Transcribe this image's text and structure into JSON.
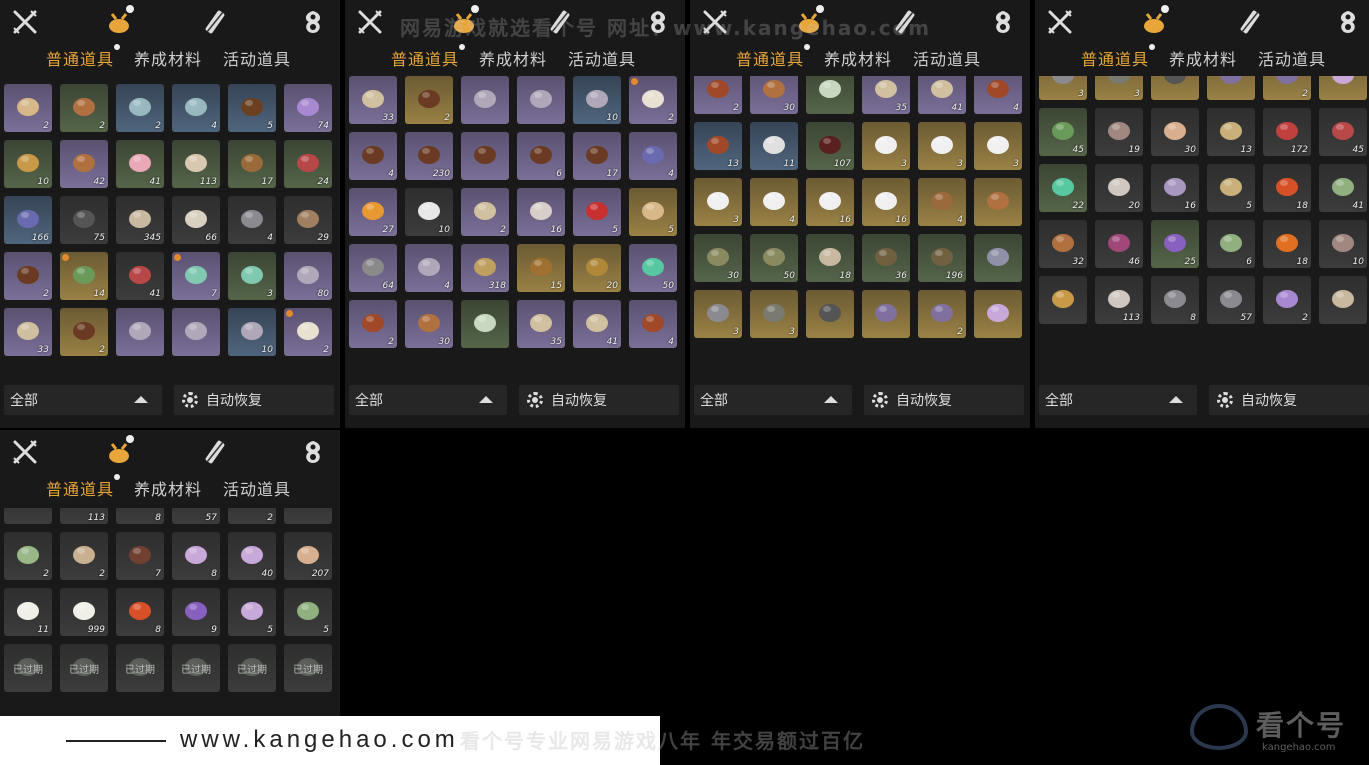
{
  "colors": {
    "tab_active": "#e8a63a",
    "tab_inactive": "#d0d0d0",
    "panel_bg": "#191919"
  },
  "nav_icons": [
    "crossed-swords-icon",
    "pouch-icon",
    "scroll-icon",
    "spirit-icon"
  ],
  "tabs": [
    "普通道具",
    "养成材料",
    "活动道具"
  ],
  "footer": {
    "filter": "全部",
    "auto": "自动恢复"
  },
  "expired_label": "已过期",
  "watermark": "网易游戏就选看个号   网址：www.kangehao.com",
  "banner": {
    "url": "www.kangehao.com",
    "slogan": "看个号专业网易游戏八年   年交易额过百亿"
  },
  "logo": {
    "name": "看个号",
    "site": "kangehao.com"
  },
  "panels": [
    {
      "items": [
        {
          "c": "2",
          "bg": "purple",
          "icon": "banner-icon"
        },
        {
          "c": "2",
          "bg": "green",
          "icon": "food-bowl-icon"
        },
        {
          "c": "2",
          "bg": "blue",
          "icon": "cloth-bag-icon"
        },
        {
          "c": "4",
          "bg": "blue",
          "icon": "cloth-bag-icon"
        },
        {
          "c": "5",
          "bg": "blue",
          "icon": "nuts-icon"
        },
        {
          "c": "74",
          "bg": "purple",
          "icon": "crystal-icon"
        },
        {
          "c": "10",
          "bg": "green",
          "icon": "ore-icon"
        },
        {
          "c": "42",
          "bg": "purple",
          "icon": "food-bowl-icon"
        },
        {
          "c": "41",
          "bg": "green",
          "icon": "blossom-icon"
        },
        {
          "c": "113",
          "bg": "green",
          "icon": "mushroom-icon"
        },
        {
          "c": "17",
          "bg": "green",
          "icon": "wood-icon"
        },
        {
          "c": "24",
          "bg": "green",
          "icon": "meat-icon"
        },
        {
          "c": "166",
          "bg": "blue",
          "icon": "box-icon"
        },
        {
          "c": "75",
          "bg": "grey",
          "icon": "insect-icon"
        },
        {
          "c": "345",
          "bg": "grey",
          "icon": "sack-icon"
        },
        {
          "c": "66",
          "bg": "grey",
          "icon": "eggs-icon"
        },
        {
          "c": "4",
          "bg": "grey",
          "icon": "stone-icon"
        },
        {
          "c": "29",
          "bg": "grey",
          "icon": "sticks-icon"
        },
        {
          "c": "2",
          "bg": "purple",
          "icon": "chest-icon"
        },
        {
          "c": "14",
          "bg": "gold",
          "icon": "bamboo-icon",
          "dot": true
        },
        {
          "c": "41",
          "bg": "grey",
          "icon": "meat-icon"
        },
        {
          "c": "7",
          "bg": "purple",
          "icon": "tickets-icon",
          "dot": true
        },
        {
          "c": "3",
          "bg": "green",
          "icon": "tickets-icon"
        },
        {
          "c": "80",
          "bg": "purple",
          "icon": "pouch-icon"
        },
        {
          "c": "33",
          "bg": "purple",
          "icon": "letter-icon"
        },
        {
          "c": "2",
          "bg": "gold",
          "icon": "chest-icon"
        },
        {
          "c": "",
          "bg": "purple",
          "icon": "pouch-icon"
        },
        {
          "c": "",
          "bg": "purple",
          "icon": "pouch-icon"
        },
        {
          "c": "10",
          "bg": "blue",
          "icon": "pouch-icon"
        },
        {
          "c": "2",
          "bg": "purple",
          "icon": "gourd-icon",
          "dot": true
        }
      ]
    },
    {
      "items": [
        {
          "c": "33",
          "bg": "purple",
          "icon": "letter-icon"
        },
        {
          "c": "2",
          "bg": "gold",
          "icon": "chest-icon"
        },
        {
          "c": "",
          "bg": "purple",
          "icon": "pouch-icon"
        },
        {
          "c": "",
          "bg": "purple",
          "icon": "pouch-icon"
        },
        {
          "c": "10",
          "bg": "blue",
          "icon": "pouch-icon"
        },
        {
          "c": "2",
          "bg": "purple",
          "icon": "gourd-icon",
          "dot": true
        },
        {
          "c": "4",
          "bg": "purple",
          "icon": "chest-icon"
        },
        {
          "c": "230",
          "bg": "purple",
          "icon": "chest-icon"
        },
        {
          "c": "",
          "bg": "purple",
          "icon": "chest-icon"
        },
        {
          "c": "6",
          "bg": "purple",
          "icon": "chest-icon"
        },
        {
          "c": "17",
          "bg": "purple",
          "icon": "chest-icon"
        },
        {
          "c": "4",
          "bg": "purple",
          "icon": "box-icon"
        },
        {
          "c": "27",
          "bg": "purple",
          "icon": "orb-icon"
        },
        {
          "c": "10",
          "bg": "grey",
          "icon": "mountain-token-icon"
        },
        {
          "c": "2",
          "bg": "purple",
          "icon": "letter-icon"
        },
        {
          "c": "16",
          "bg": "purple",
          "icon": "jar-icon"
        },
        {
          "c": "5",
          "bg": "purple",
          "icon": "red-envelope-icon"
        },
        {
          "c": "5",
          "bg": "gold",
          "icon": "banner-icon"
        },
        {
          "c": "64",
          "bg": "purple",
          "icon": "token-icon"
        },
        {
          "c": "4",
          "bg": "purple",
          "icon": "pouch-icon"
        },
        {
          "c": "318",
          "bg": "purple",
          "icon": "ladder-icon"
        },
        {
          "c": "15",
          "bg": "gold",
          "icon": "helmet-icon"
        },
        {
          "c": "20",
          "bg": "gold",
          "icon": "coin-icon"
        },
        {
          "c": "50",
          "bg": "purple",
          "icon": "jade-icon"
        },
        {
          "c": "2",
          "bg": "purple",
          "icon": "horn-icon"
        },
        {
          "c": "30",
          "bg": "purple",
          "icon": "food-bowl-icon"
        },
        {
          "c": "",
          "bg": "green",
          "icon": "vase-icon"
        },
        {
          "c": "35",
          "bg": "purple",
          "icon": "letter-icon"
        },
        {
          "c": "41",
          "bg": "purple",
          "icon": "letter-icon"
        },
        {
          "c": "4",
          "bg": "purple",
          "icon": "horn-icon"
        }
      ]
    },
    {
      "items": [
        {
          "c": "2",
          "bg": "purple",
          "icon": "horn-icon"
        },
        {
          "c": "30",
          "bg": "purple",
          "icon": "food-bowl-icon"
        },
        {
          "c": "",
          "bg": "green",
          "icon": "vase-icon"
        },
        {
          "c": "35",
          "bg": "purple",
          "icon": "letter-icon"
        },
        {
          "c": "41",
          "bg": "purple",
          "icon": "letter-icon"
        },
        {
          "c": "4",
          "bg": "purple",
          "icon": "horn-icon"
        },
        {
          "c": "13",
          "bg": "blue",
          "icon": "horn-icon"
        },
        {
          "c": "11",
          "bg": "blue",
          "icon": "teapot-icon"
        },
        {
          "c": "107",
          "bg": "green",
          "icon": "wine-jar-icon"
        },
        {
          "c": "3",
          "bg": "gold",
          "icon": "bowl-icon"
        },
        {
          "c": "3",
          "bg": "gold",
          "icon": "bowl-icon"
        },
        {
          "c": "3",
          "bg": "gold",
          "icon": "bowl-icon"
        },
        {
          "c": "3",
          "bg": "gold",
          "icon": "bowl-icon"
        },
        {
          "c": "4",
          "bg": "gold",
          "icon": "bowl-icon"
        },
        {
          "c": "16",
          "bg": "gold",
          "icon": "plate-icon"
        },
        {
          "c": "16",
          "bg": "gold",
          "icon": "bowl-icon"
        },
        {
          "c": "4",
          "bg": "gold",
          "icon": "wood-icon"
        },
        {
          "c": "",
          "bg": "gold",
          "icon": "food-bowl-icon"
        },
        {
          "c": "30",
          "bg": "green",
          "icon": "powder-icon"
        },
        {
          "c": "50",
          "bg": "green",
          "icon": "powder-icon"
        },
        {
          "c": "18",
          "bg": "green",
          "icon": "sack-icon"
        },
        {
          "c": "36",
          "bg": "green",
          "icon": "arrow-icon"
        },
        {
          "c": "196",
          "bg": "green",
          "icon": "arrow-icon"
        },
        {
          "c": "",
          "bg": "green",
          "icon": "net-icon"
        },
        {
          "c": "3",
          "bg": "gold",
          "icon": "stone-icon"
        },
        {
          "c": "3",
          "bg": "gold",
          "icon": "egg-icon"
        },
        {
          "c": "",
          "bg": "gold",
          "icon": "insect-icon"
        },
        {
          "c": "",
          "bg": "gold",
          "icon": "dragonfly-icon"
        },
        {
          "c": "2",
          "bg": "gold",
          "icon": "dragonfly-icon"
        },
        {
          "c": "",
          "bg": "gold",
          "icon": "flower-icon"
        }
      ]
    },
    {
      "items": [
        {
          "c": "3",
          "bg": "gold",
          "icon": "stone-icon"
        },
        {
          "c": "3",
          "bg": "gold",
          "icon": "egg-icon"
        },
        {
          "c": "",
          "bg": "gold",
          "icon": "insect-icon"
        },
        {
          "c": "",
          "bg": "gold",
          "icon": "dragonfly-icon"
        },
        {
          "c": "2",
          "bg": "gold",
          "icon": "dragonfly-icon"
        },
        {
          "c": "",
          "bg": "gold",
          "icon": "flower-icon"
        },
        {
          "c": "45",
          "bg": "green",
          "icon": "bamboo-icon"
        },
        {
          "c": "19",
          "bg": "grey",
          "icon": "feather-icon"
        },
        {
          "c": "30",
          "bg": "grey",
          "icon": "shell-icon"
        },
        {
          "c": "13",
          "bg": "grey",
          "icon": "fish-icon"
        },
        {
          "c": "172",
          "bg": "grey",
          "icon": "berries-icon"
        },
        {
          "c": "45",
          "bg": "grey",
          "icon": "meat-icon"
        },
        {
          "c": "22",
          "bg": "green",
          "icon": "jade-icon"
        },
        {
          "c": "20",
          "bg": "grey",
          "icon": "fur-icon"
        },
        {
          "c": "16",
          "bg": "grey",
          "icon": "worm-icon"
        },
        {
          "c": "5",
          "bg": "grey",
          "icon": "fish-icon"
        },
        {
          "c": "18",
          "bg": "grey",
          "icon": "red-pill-icon"
        },
        {
          "c": "41",
          "bg": "grey",
          "icon": "herb-icon"
        },
        {
          "c": "32",
          "bg": "grey",
          "icon": "food-bowl-icon"
        },
        {
          "c": "46",
          "bg": "grey",
          "icon": "petals-icon"
        },
        {
          "c": "25",
          "bg": "green",
          "icon": "lavender-icon"
        },
        {
          "c": "6",
          "bg": "grey",
          "icon": "herb-icon"
        },
        {
          "c": "18",
          "bg": "grey",
          "icon": "orange-flower-icon"
        },
        {
          "c": "10",
          "bg": "grey",
          "icon": "feather-icon"
        },
        {
          "c": "",
          "bg": "grey",
          "icon": "ore-icon"
        },
        {
          "c": "113",
          "bg": "grey",
          "icon": "fur-icon"
        },
        {
          "c": "8",
          "bg": "grey",
          "icon": "stone-icon"
        },
        {
          "c": "57",
          "bg": "grey",
          "icon": "stone-icon"
        },
        {
          "c": "2",
          "bg": "grey",
          "icon": "crystal-icon"
        },
        {
          "c": "",
          "bg": "grey",
          "icon": "bone-icon"
        }
      ]
    },
    {
      "items": [
        {
          "c": "",
          "bg": "grey",
          "icon": "ore-icon"
        },
        {
          "c": "113",
          "bg": "grey",
          "icon": "fur-icon"
        },
        {
          "c": "8",
          "bg": "grey",
          "icon": "stone-icon"
        },
        {
          "c": "57",
          "bg": "grey",
          "icon": "stone-icon"
        },
        {
          "c": "2",
          "bg": "grey",
          "icon": "crystal-icon"
        },
        {
          "c": "",
          "bg": "grey",
          "icon": "bone-icon"
        },
        {
          "c": "2",
          "bg": "grey",
          "icon": "melon-icon"
        },
        {
          "c": "2",
          "bg": "grey",
          "icon": "bundle-icon"
        },
        {
          "c": "7",
          "bg": "grey",
          "icon": "twig-icon"
        },
        {
          "c": "8",
          "bg": "grey",
          "icon": "flower-icon"
        },
        {
          "c": "40",
          "bg": "grey",
          "icon": "flower-icon"
        },
        {
          "c": "207",
          "bg": "grey",
          "icon": "shell-icon"
        },
        {
          "c": "11",
          "bg": "grey",
          "icon": "rice-bowl-icon"
        },
        {
          "c": "999",
          "bg": "grey",
          "icon": "rice-bowl-icon"
        },
        {
          "c": "8",
          "bg": "grey",
          "icon": "red-pill-icon"
        },
        {
          "c": "9",
          "bg": "grey",
          "icon": "lavender-icon"
        },
        {
          "c": "5",
          "bg": "grey",
          "icon": "flower-icon"
        },
        {
          "c": "5",
          "bg": "grey",
          "icon": "herb-icon"
        },
        {
          "c": "",
          "bg": "grey",
          "icon": "vase-icon",
          "expired": true
        },
        {
          "c": "",
          "bg": "grey",
          "icon": "vase-icon",
          "expired": true
        },
        {
          "c": "",
          "bg": "grey",
          "icon": "vase-icon",
          "expired": true
        },
        {
          "c": "",
          "bg": "grey",
          "icon": "vase-icon",
          "expired": true
        },
        {
          "c": "",
          "bg": "grey",
          "icon": "vase-icon",
          "expired": true
        },
        {
          "c": "",
          "bg": "grey",
          "icon": "vase-icon",
          "expired": true
        }
      ]
    }
  ]
}
